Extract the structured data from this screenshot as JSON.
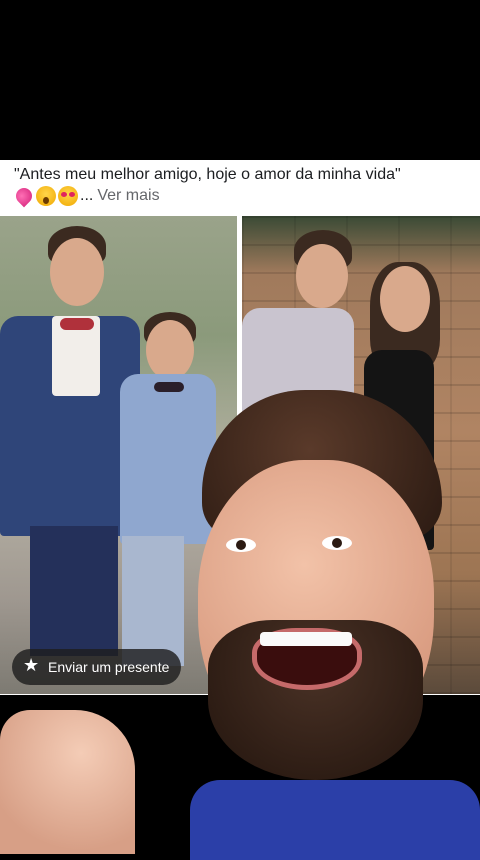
{
  "post": {
    "caption_line1": "\"Antes meu melhor amigo, hoje o amor da minha vida\"",
    "caption_emojis": [
      "two-hearts",
      "face-screaming",
      "heart-eyes"
    ],
    "ellipsis": "...",
    "more_label": "Ver mais",
    "gift_label": "Enviar um presente"
  },
  "icons": {
    "gift": "star-gift-icon"
  }
}
